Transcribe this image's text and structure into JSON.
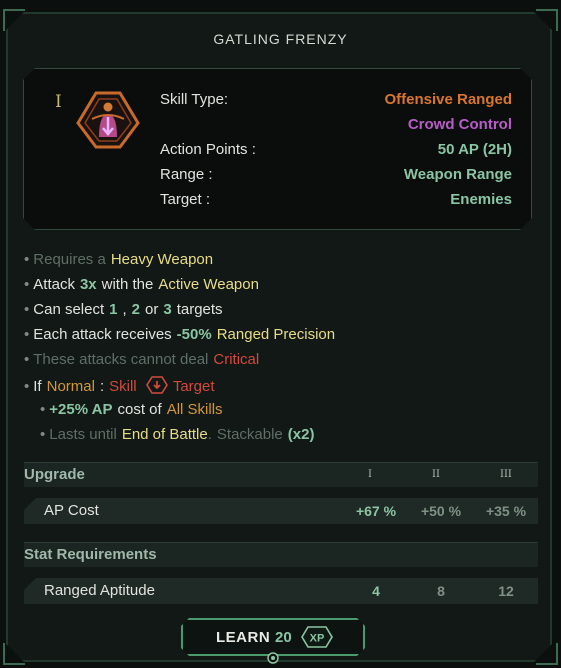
{
  "title": "GATLING FRENZY",
  "tier": "I",
  "skill_icon": "targeting-person-icon",
  "info": [
    {
      "label": "Skill Type:",
      "value": "Offensive Ranged",
      "color": "#d9762e"
    },
    {
      "label": "",
      "value": "Crowd Control",
      "color": "#b85cc8"
    },
    {
      "label": "Action Points :",
      "value": "50 AP  (2H)",
      "color": "#8bc5a3"
    },
    {
      "label": "Range :",
      "value": "Weapon Range",
      "color": "#8bc5a3"
    },
    {
      "label": "Target :",
      "value": "Enemies",
      "color": "#8bc5a3"
    }
  ],
  "desc": {
    "l1": {
      "a": "Requires a",
      "b": "Heavy Weapon"
    },
    "l2": {
      "a": "Attack",
      "b": "3x",
      "c": "with the",
      "d": "Active Weapon"
    },
    "l3": {
      "a": "Can select",
      "b": "1",
      "c": ",",
      "d": "2",
      "e": "or",
      "f": "3",
      "g": "targets"
    },
    "l4": {
      "a": "Each attack receives",
      "b": "-50%",
      "c": "Ranged Precision"
    },
    "l5": {
      "a": "These attacks cannot deal",
      "b": "Critical"
    },
    "l6": {
      "a": "If",
      "b": "Normal",
      "c": ":",
      "d": "Skill",
      "e": "Target"
    },
    "l7": {
      "a": "+25% AP",
      "b": "cost of",
      "c": "All Skills"
    },
    "l8": {
      "a": "Lasts until",
      "b": "End of Battle",
      "c": ".",
      "d": "Stackable",
      "e": "(x2)"
    }
  },
  "upgrade": {
    "header": "Upgrade",
    "tiers": [
      "I",
      "II",
      "III"
    ],
    "row_label": "AP Cost",
    "values": [
      "+67 %",
      "+50 %",
      "+35 %"
    ]
  },
  "requirements": {
    "header": "Stat Requirements",
    "row_label": "Ranged Aptitude",
    "values": [
      "4",
      "8",
      "12"
    ]
  },
  "learn": {
    "label": "LEARN",
    "cost": "20",
    "currency": "XP"
  }
}
